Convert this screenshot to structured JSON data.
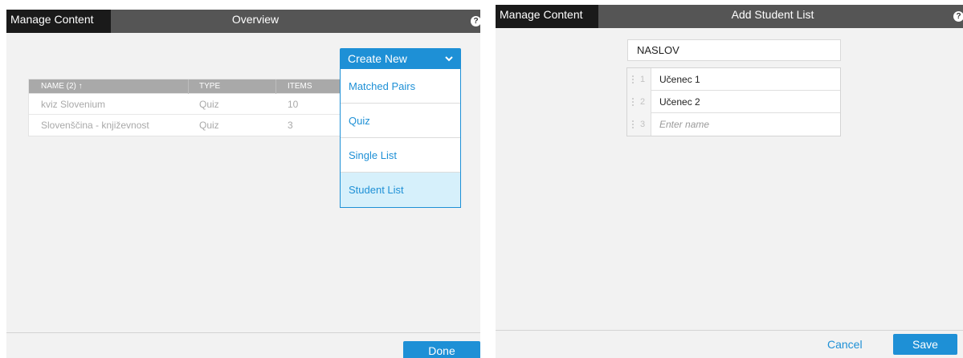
{
  "left": {
    "tab_label": "Manage Content",
    "title": "Overview",
    "help_glyph": "?",
    "table": {
      "headers": [
        "NAME (2) ↑",
        "TYPE",
        "ITEMS"
      ],
      "rows": [
        [
          "kviz Slovenium",
          "Quiz",
          "10"
        ],
        [
          "Slovenščina - književnost",
          "Quiz",
          "3"
        ]
      ]
    },
    "create_menu": {
      "label": "Create New",
      "items": [
        "Matched Pairs",
        "Quiz",
        "Single List",
        "Student List"
      ],
      "highlighted": "Student List"
    },
    "done_label": "Done"
  },
  "right": {
    "tab_label": "Manage Content",
    "title": "Add Student List",
    "help_glyph": "?",
    "title_field_value": "NASLOV",
    "students": [
      {
        "num": "1",
        "name": "Učenec 1"
      },
      {
        "num": "2",
        "name": "Učenec 2"
      }
    ],
    "new_row": {
      "num": "3",
      "placeholder": "Enter name"
    },
    "cancel_label": "Cancel",
    "save_label": "Save"
  },
  "colors": {
    "accent": "#1e90d6",
    "dark_bar": "#555555",
    "active_tab": "#1a1a1a",
    "highlight": "#d6f0fb"
  },
  "icons": {
    "help": "help-icon",
    "dropdown": "chevron-down-icon",
    "drag": "drag-handle-icon"
  }
}
